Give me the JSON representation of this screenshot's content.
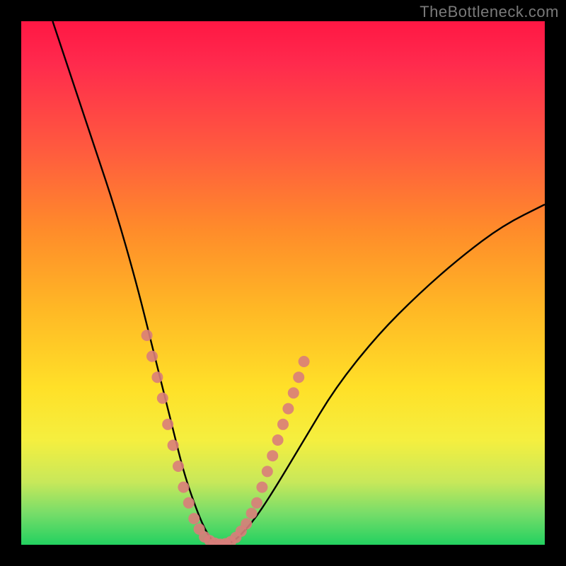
{
  "watermark": "TheBottleneck.com",
  "chart_data": {
    "type": "line",
    "title": "",
    "xlabel": "",
    "ylabel": "",
    "xlim": [
      0,
      100
    ],
    "ylim": [
      0,
      100
    ],
    "series": [
      {
        "name": "bottleneck-curve",
        "x": [
          6,
          10,
          14,
          18,
          22,
          25,
          27,
          29,
          31,
          33,
          35,
          37,
          40,
          44,
          48,
          54,
          60,
          68,
          76,
          84,
          92,
          100
        ],
        "y": [
          100,
          88,
          76,
          64,
          50,
          38,
          30,
          22,
          14,
          8,
          3,
          0,
          0,
          4,
          10,
          20,
          30,
          40,
          48,
          55,
          61,
          65
        ]
      }
    ],
    "highlight_band_y": [
      0,
      22
    ],
    "gradient_stops": [
      {
        "pos": 0,
        "color": "#ff1744"
      },
      {
        "pos": 25,
        "color": "#ff5c3e"
      },
      {
        "pos": 55,
        "color": "#ffb825"
      },
      {
        "pos": 80,
        "color": "#f5ef3f"
      },
      {
        "pos": 100,
        "color": "#23d160"
      }
    ],
    "highlight_points": [
      {
        "x": 24,
        "y": 40
      },
      {
        "x": 25,
        "y": 36
      },
      {
        "x": 26,
        "y": 32
      },
      {
        "x": 27,
        "y": 28
      },
      {
        "x": 28,
        "y": 23
      },
      {
        "x": 29,
        "y": 19
      },
      {
        "x": 30,
        "y": 15
      },
      {
        "x": 31,
        "y": 11
      },
      {
        "x": 32,
        "y": 8
      },
      {
        "x": 33,
        "y": 5
      },
      {
        "x": 34,
        "y": 3
      },
      {
        "x": 35,
        "y": 1.5
      },
      {
        "x": 36,
        "y": 0.8
      },
      {
        "x": 37,
        "y": 0.3
      },
      {
        "x": 38,
        "y": 0.1
      },
      {
        "x": 39,
        "y": 0.2
      },
      {
        "x": 40,
        "y": 0.6
      },
      {
        "x": 41,
        "y": 1.4
      },
      {
        "x": 42,
        "y": 2.6
      },
      {
        "x": 43,
        "y": 4
      },
      {
        "x": 44,
        "y": 6
      },
      {
        "x": 45,
        "y": 8
      },
      {
        "x": 46,
        "y": 11
      },
      {
        "x": 47,
        "y": 14
      },
      {
        "x": 48,
        "y": 17
      },
      {
        "x": 49,
        "y": 20
      },
      {
        "x": 50,
        "y": 23
      },
      {
        "x": 51,
        "y": 26
      },
      {
        "x": 52,
        "y": 29
      },
      {
        "x": 53,
        "y": 32
      },
      {
        "x": 54,
        "y": 35
      }
    ]
  }
}
